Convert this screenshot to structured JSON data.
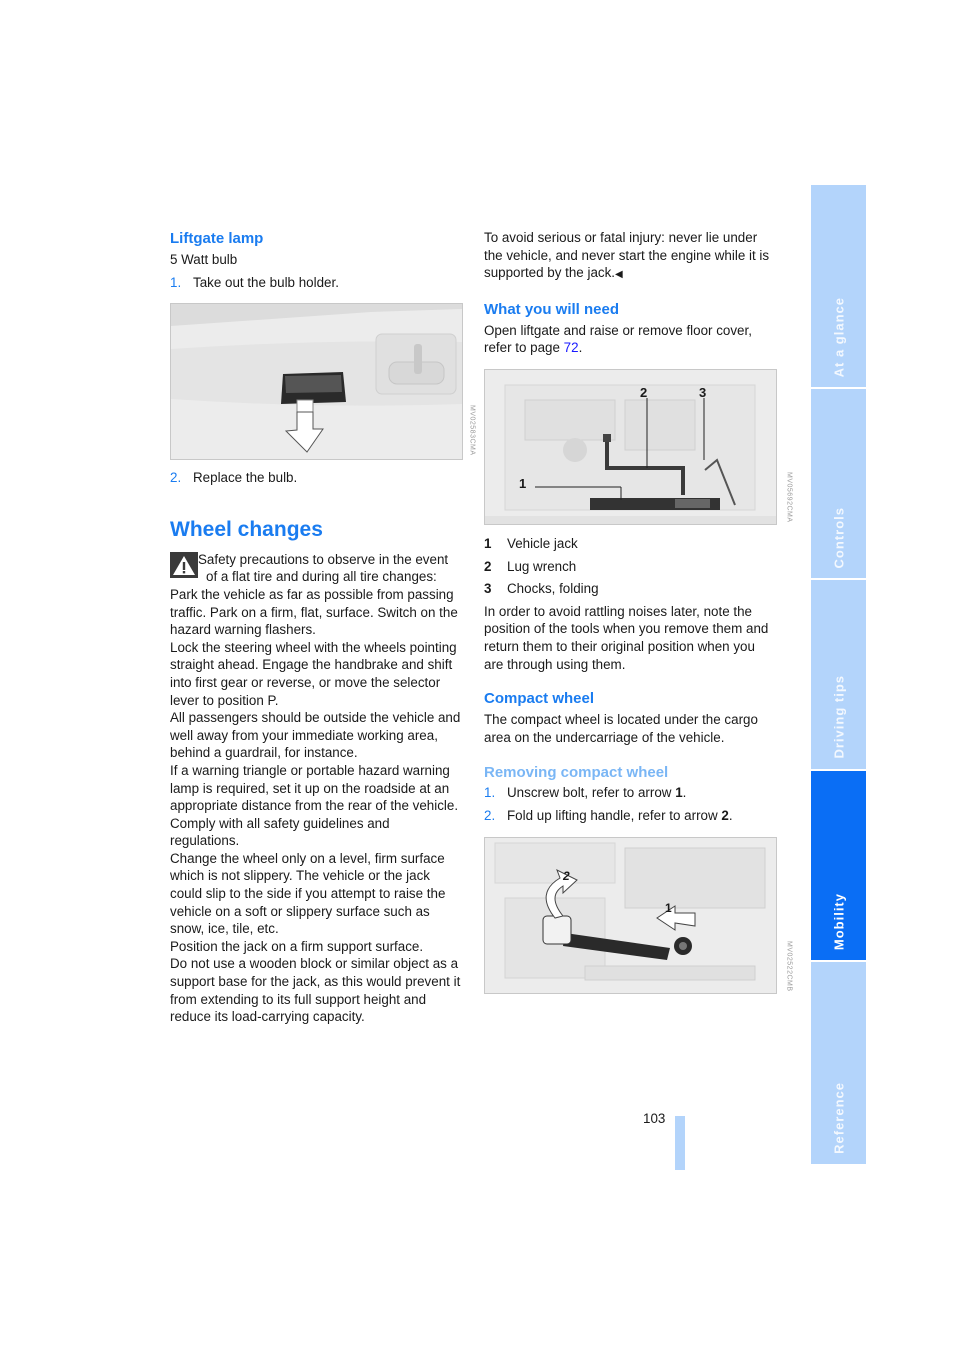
{
  "left_column": {
    "liftgate": {
      "heading": "Liftgate lamp",
      "subtitle": "5 Watt bulb",
      "steps": [
        {
          "num": "1.",
          "text": "Take out the bulb holder."
        },
        {
          "num": "2.",
          "text": "Replace the bulb."
        }
      ],
      "figure_code": "MV02583CMA"
    },
    "wheel_changes": {
      "heading": "Wheel changes",
      "warning_icon": "warning-triangle-icon",
      "warning_lead": "Safety precautions to observe in the event of a flat tire and during all tire changes:",
      "paragraphs": [
        "Park the vehicle as far as possible from passing traffic. Park on a firm, flat, surface. Switch on the hazard warning flashers.",
        "Lock the steering wheel with the wheels pointing straight ahead. Engage the handbrake and shift into first gear or reverse, or move the selector lever to position P.",
        "All passengers should be outside the vehicle and well away from your immediate working area, behind a guardrail, for instance.",
        "If a warning triangle or portable hazard warning lamp is required, set it up on the roadside at an appropriate distance from the rear of the vehicle. Comply with all safety guidelines and regulations.",
        "Change the wheel only on a level, firm surface which is not slippery. The vehicle or the jack could slip to the side if you attempt to raise the vehicle on a soft or slippery surface such as snow, ice, tile, etc.",
        "Position the jack on a firm support surface.",
        "Do not use a wooden block or similar object as a support base for the jack, as this would prevent it from extending to its full support height and reduce its load-carrying capacity."
      ]
    }
  },
  "right_column": {
    "warning_end": "To avoid serious or fatal injury: never lie under the vehicle, and never start the engine while it is supported by the jack.",
    "end_mark": "◀",
    "what_you_need": {
      "heading": "What you will need",
      "text_before": "Open liftgate and raise or remove floor cover, refer to page ",
      "page_link": "72",
      "text_after": ".",
      "figure_code": "MV05692CMA",
      "figure_labels": [
        "1",
        "2",
        "3"
      ],
      "legend": [
        {
          "num": "1",
          "text": "Vehicle jack"
        },
        {
          "num": "2",
          "text": "Lug wrench"
        },
        {
          "num": "3",
          "text": "Chocks, folding"
        }
      ],
      "note": "In order to avoid rattling noises later, note the position of the tools when you remove them and return them to their original position when you are through using them."
    },
    "compact_wheel": {
      "heading": "Compact wheel",
      "text": "The compact wheel is located under the cargo area on the undercarriage of the vehicle."
    },
    "removing": {
      "heading": "Removing compact wheel",
      "steps": [
        {
          "num": "1.",
          "text": "Unscrew bolt, refer to arrow ",
          "bold": "1",
          "end": "."
        },
        {
          "num": "2.",
          "text": "Fold up lifting handle, refer to arrow ",
          "bold": "2",
          "end": "."
        }
      ],
      "figure_code": "MV02522CMB",
      "figure_labels": [
        "1",
        "2"
      ]
    }
  },
  "sidebar": {
    "tabs": [
      {
        "label": "At a glance",
        "active": false
      },
      {
        "label": "Controls",
        "active": false
      },
      {
        "label": "Driving tips",
        "active": false
      },
      {
        "label": "Mobility",
        "active": true
      },
      {
        "label": "Reference",
        "active": false
      }
    ]
  },
  "footer": {
    "page_number": "103"
  },
  "colors": {
    "heading_blue": "#1a7cf0",
    "subheading_light_blue": "#7ab6f5",
    "tab_inactive": "#b3d4fb",
    "tab_active": "#0a6ef5"
  }
}
